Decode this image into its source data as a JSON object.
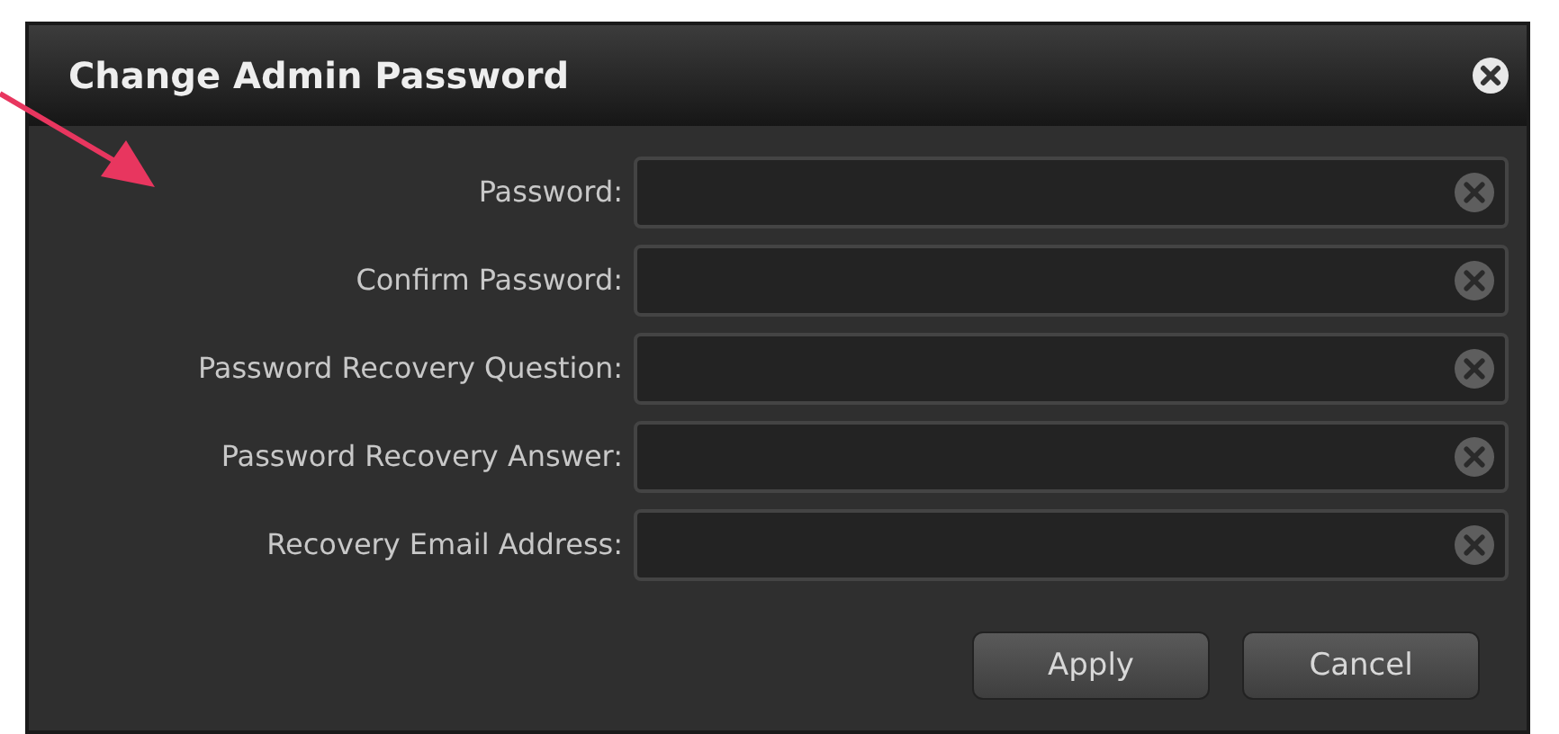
{
  "dialog": {
    "title": "Change Admin Password"
  },
  "fields": [
    {
      "label": "Password:"
    },
    {
      "label": "Confirm Password:"
    },
    {
      "label": "Password Recovery Question:"
    },
    {
      "label": "Password Recovery Answer:"
    },
    {
      "label": "Recovery Email Address:"
    }
  ],
  "buttons": [
    "Apply",
    "Cancel"
  ]
}
